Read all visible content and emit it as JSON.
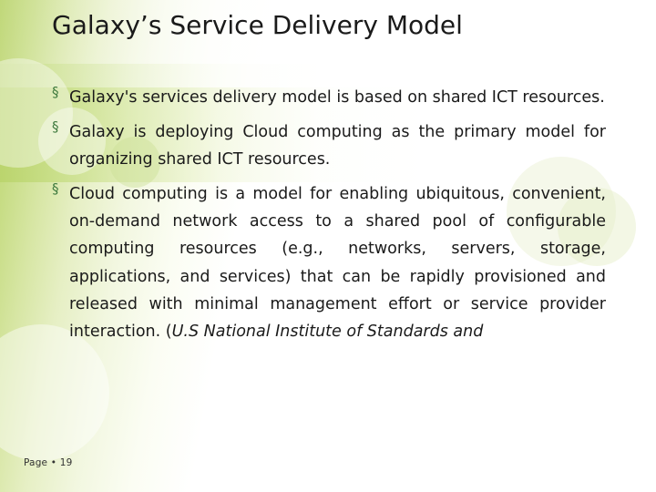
{
  "slide": {
    "title": "Galaxy’s Service Delivery Model",
    "bullet_marker": "§",
    "bullets": [
      "Galaxy's services delivery model is based on shared ICT resources.",
      "Galaxy is deploying Cloud computing as the primary model for organizing shared ICT resources.",
      "Cloud computing is a model for enabling ubiquitous, convenient, on-demand network access to a shared pool of configurable computing resources (e.g., networks, servers, storage, applications, and services) that can be rapidly provisioned and released with minimal management effort or service provider interaction. ("
    ],
    "bullet3_italic_tail": "U.S National Institute of Standards and",
    "page_label": "Page • 19",
    "colors": {
      "accent_green": "#b9d36a",
      "bullet_marker": "#3f7a3f",
      "text": "#1a1a1a"
    }
  }
}
